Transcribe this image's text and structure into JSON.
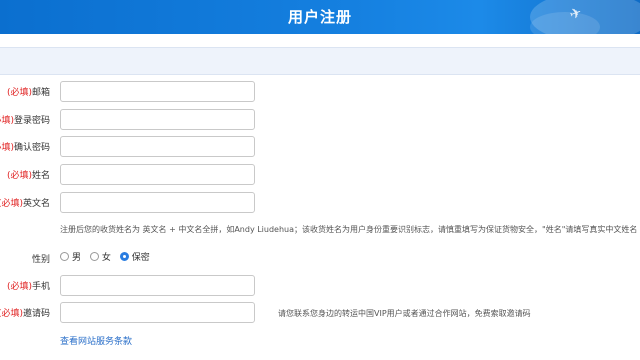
{
  "header": {
    "title": "用户注册"
  },
  "form": {
    "required_tag": "(必填)",
    "fields": [
      {
        "label": "邮箱",
        "value": ""
      },
      {
        "label": "登录密码",
        "value": ""
      },
      {
        "label": "确认密码",
        "value": ""
      },
      {
        "label": "姓名",
        "value": ""
      },
      {
        "label": "英文名",
        "value": ""
      }
    ],
    "english_name_note": "注册后您的收货姓名为 英文名 + 中文名全拼，如Andy Liudehua；该收货姓名为用户身份重要识别标志，请慎重填写为保证货物安全，\"姓名\"请填写真实中文姓名",
    "gender": {
      "label": "性别",
      "options": [
        "男",
        "女",
        "保密"
      ],
      "selected": "保密"
    },
    "phone": {
      "label": "手机",
      "value": ""
    },
    "invite": {
      "label": "邀请码",
      "value": "",
      "note": "请您联系您身边的转运中国VIP用户或者通过合作网站，免费索取邀请码"
    },
    "terms_link": "查看网站服务条款"
  }
}
